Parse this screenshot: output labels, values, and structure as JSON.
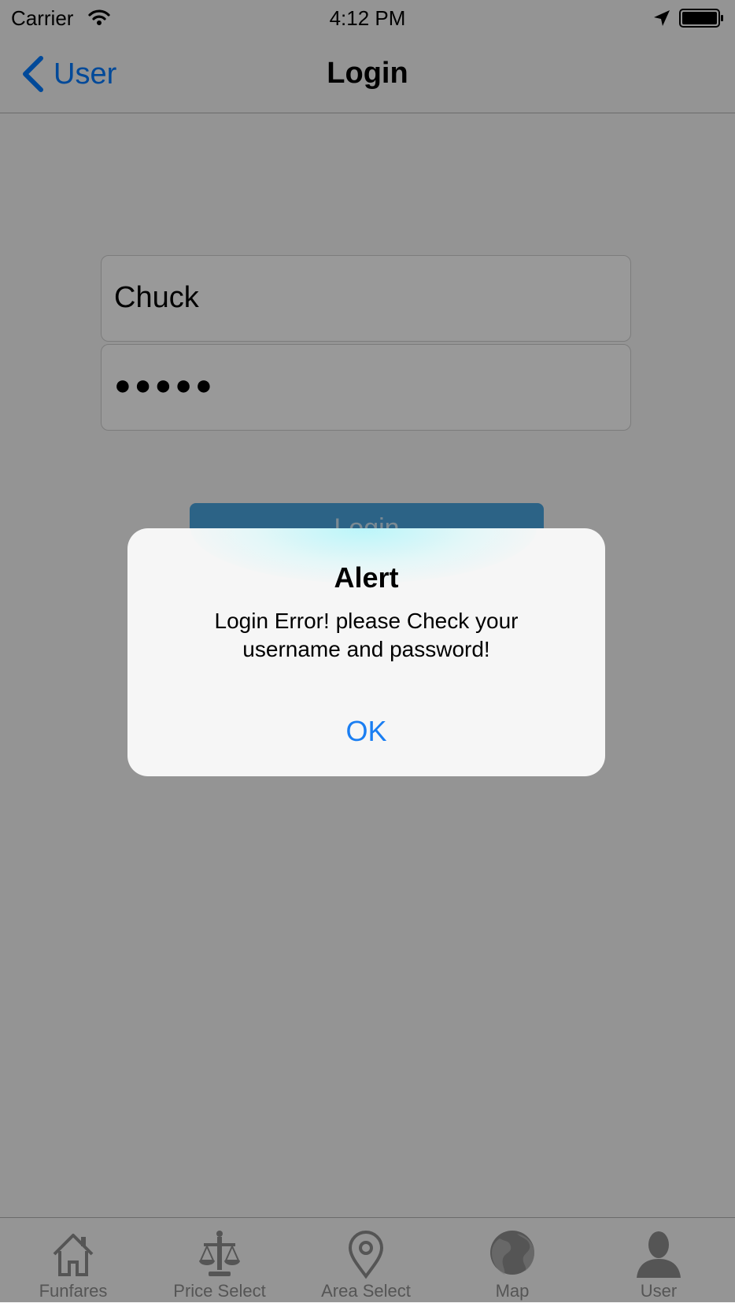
{
  "status_bar": {
    "carrier": "Carrier",
    "time": "4:12 PM"
  },
  "nav": {
    "back_label": "User",
    "title": "Login"
  },
  "form": {
    "username_value": "Chuck",
    "password_mask": "●●●●●",
    "login_label": "Login"
  },
  "tab_bar": {
    "tabs": [
      {
        "label": "Funfares",
        "icon": "house-icon"
      },
      {
        "label": "Price Select",
        "icon": "scales-icon"
      },
      {
        "label": "Area Select",
        "icon": "map-pin-icon"
      },
      {
        "label": "Map",
        "icon": "globe-icon"
      },
      {
        "label": "User",
        "icon": "person-icon"
      }
    ]
  },
  "alert": {
    "title": "Alert",
    "message": "Login Error! please Check your username and password!",
    "ok_label": "OK"
  },
  "colors": {
    "accent": "#007aff",
    "alert_button": "#1a7ef2",
    "login_button": "#4aa6e0"
  }
}
